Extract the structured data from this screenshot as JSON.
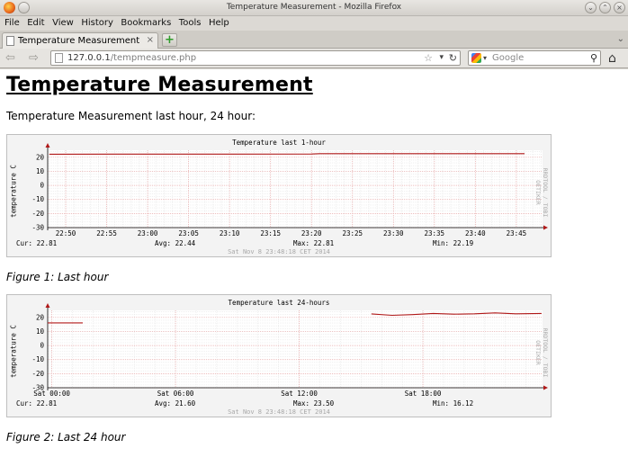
{
  "window": {
    "title": "Temperature Measurement - Mozilla Firefox"
  },
  "menu": [
    "File",
    "Edit",
    "View",
    "History",
    "Bookmarks",
    "Tools",
    "Help"
  ],
  "tab": {
    "label": "Temperature Measurement"
  },
  "nav": {
    "url_host": "127.0.0.1",
    "url_path": "/tempmeasure.php",
    "search_placeholder": "Google"
  },
  "page": {
    "title": "Temperature Measurement",
    "intro": "Temperature Measurement last hour, 24 hour:",
    "caption1": "Figure 1: Last hour",
    "caption2": "Figure 2: Last 24 hour"
  },
  "colors": {
    "line": "#b01818",
    "grid_major": "#e8a8a8",
    "grid_minor": "#e6e6e6"
  },
  "chart_data": [
    {
      "type": "line",
      "title": "Temperature last 1-hour",
      "ylabel": "temperature C",
      "side_label": "RRDTOOL / TOBI OETIKER",
      "ylim": [
        -30,
        25
      ],
      "yticks": [
        "20",
        "10",
        "0",
        "-10",
        "-20",
        "-30"
      ],
      "xticks": [
        "22:50",
        "22:55",
        "23:00",
        "23:05",
        "23:10",
        "23:15",
        "23:20",
        "23:25",
        "23:30",
        "23:35",
        "23:40",
        "23:45"
      ],
      "series": [
        {
          "values": [
            {
              "x": "22:48",
              "y": 22.2
            },
            {
              "x": "23:20",
              "y": 22.3
            },
            {
              "x": "23:21",
              "y": 22.6
            },
            {
              "x": "23:46",
              "y": 22.6
            }
          ]
        }
      ],
      "stats": {
        "cur": "Cur:  22.81",
        "avg": "Avg:  22.44",
        "max": "Max:  22.81",
        "min": "Min:  22.19"
      },
      "date": "Sat Nov  8 23:48:18 CET 2014"
    },
    {
      "type": "line",
      "title": "Temperature last 24-hours",
      "ylabel": "temperature C",
      "side_label": "RRDTOOL / TOBI OETIKER",
      "ylim": [
        -30,
        25
      ],
      "yticks": [
        "20",
        "10",
        "0",
        "-10",
        "-20",
        "-30"
      ],
      "xticks": [
        "Sat 00:00",
        "Sat 06:00",
        "Sat 12:00",
        "Sat 18:00"
      ],
      "series": [
        {
          "values": [
            {
              "x": "Fri 23:48",
              "y": 16.1
            },
            {
              "x": "Sat 01:30",
              "y": 16.1
            }
          ]
        },
        {
          "values": [
            {
              "x": "Sat 15:30",
              "y": 22.5
            },
            {
              "x": "Sat 16:30",
              "y": 21.5
            },
            {
              "x": "Sat 17:30",
              "y": 22.0
            },
            {
              "x": "Sat 18:30",
              "y": 22.8
            },
            {
              "x": "Sat 19:30",
              "y": 22.3
            },
            {
              "x": "Sat 20:30",
              "y": 22.6
            },
            {
              "x": "Sat 21:30",
              "y": 23.2
            },
            {
              "x": "Sat 22:30",
              "y": 22.6
            },
            {
              "x": "Sat 23:45",
              "y": 22.8
            }
          ]
        }
      ],
      "stats": {
        "cur": "Cur:  22.81",
        "avg": "Avg:  21.60",
        "max": "Max:  23.50",
        "min": "Min:  16.12"
      },
      "date": "Sat Nov  8 23:48:18 CET 2014"
    }
  ]
}
